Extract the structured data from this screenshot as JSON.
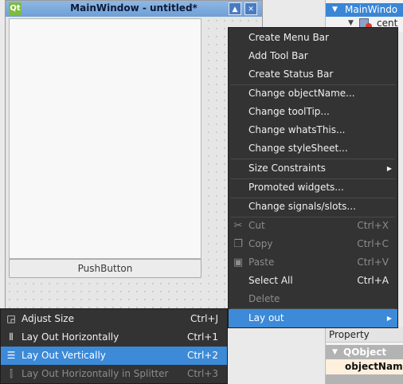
{
  "window": {
    "logo": "Qt",
    "title": "MainWindow - untitled*",
    "maximize_glyph": "▲",
    "close_glyph": "✕"
  },
  "form": {
    "pushbutton_label": "PushButton"
  },
  "object_inspector": {
    "root_label": "MainWindo",
    "child_label": "cent"
  },
  "property_editor": {
    "header": "Property",
    "group_label": "QObject",
    "row_label": "objectNam"
  },
  "context_menu": {
    "items": [
      {
        "label": "Create Menu Bar"
      },
      {
        "label": "Add Tool Bar"
      },
      {
        "label": "Create Status Bar"
      },
      {
        "label": "Change objectName..."
      },
      {
        "label": "Change toolTip..."
      },
      {
        "label": "Change whatsThis..."
      },
      {
        "label": "Change styleSheet..."
      },
      {
        "label": "Size Constraints"
      },
      {
        "label": "Promoted widgets..."
      },
      {
        "label": "Change signals/slots..."
      },
      {
        "label": "Cut",
        "shortcut": "Ctrl+X",
        "icon": "scissors-icon"
      },
      {
        "label": "Copy",
        "shortcut": "Ctrl+C",
        "icon": "copy-icon"
      },
      {
        "label": "Paste",
        "shortcut": "Ctrl+V",
        "icon": "paste-icon"
      },
      {
        "label": "Select All",
        "shortcut": "Ctrl+A"
      },
      {
        "label": "Delete"
      },
      {
        "label": "Lay out"
      }
    ]
  },
  "layout_submenu": {
    "items": [
      {
        "label": "Adjust Size",
        "shortcut": "Ctrl+J",
        "icon": "adjust-size-icon"
      },
      {
        "label": "Lay Out Horizontally",
        "shortcut": "Ctrl+1",
        "icon": "horizontal-layout-icon"
      },
      {
        "label": "Lay Out Vertically",
        "shortcut": "Ctrl+2",
        "icon": "vertical-layout-icon"
      },
      {
        "label": "Lay Out Horizontally in Splitter",
        "shortcut": "Ctrl+3",
        "icon": "splitter-icon"
      }
    ]
  },
  "colors": {
    "menu_bg": "#333333",
    "highlight": "#3c8ad8",
    "disabled_text": "#8c8c8c"
  }
}
